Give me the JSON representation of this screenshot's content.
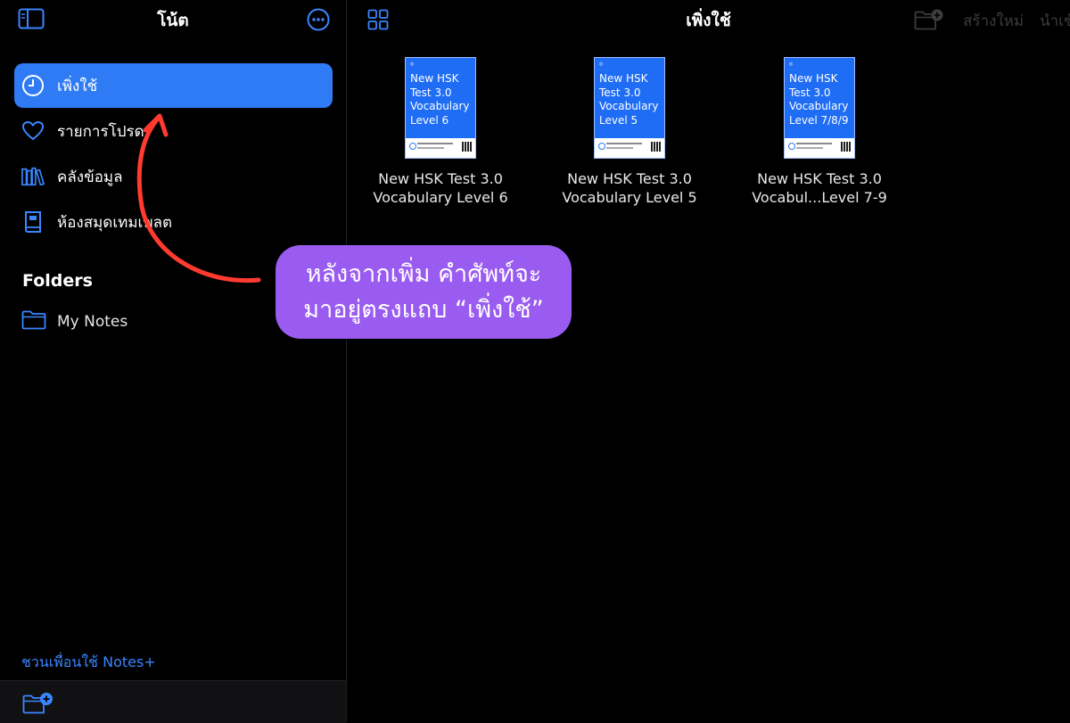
{
  "sidebar": {
    "title": "โน้ต",
    "items": [
      {
        "label": "เพิ่งใช้",
        "icon": "clock-icon",
        "active": true
      },
      {
        "label": "รายการโปรด",
        "icon": "heart-icon",
        "active": false
      },
      {
        "label": "คลังข้อมูล",
        "icon": "library-icon",
        "active": false
      },
      {
        "label": "ห้องสมุดเทมเพลต",
        "icon": "template-book-icon",
        "active": false
      }
    ],
    "folders_heading": "Folders",
    "folders": [
      {
        "label": "My Notes",
        "icon": "folder-icon"
      }
    ],
    "invite_text": "ชวนเพื่อนใช้ Notes+"
  },
  "main": {
    "title": "เพิ่งใช้",
    "create_new": "สร้างใหม่",
    "import": "นำเข้า",
    "documents": [
      {
        "cover_title": "New HSK Test 3.0 Vocabulary Level 6",
        "name_line1": "New HSK Test 3.0",
        "name_line2": "Vocabulary Level 6"
      },
      {
        "cover_title": "New HSK Test 3.0 Vocabulary Level 5",
        "name_line1": "New HSK Test 3.0",
        "name_line2": "Vocabulary Level 5"
      },
      {
        "cover_title": "New HSK Test 3.0 Vocabulary Level 7/8/9",
        "name_line1": "New HSK Test 3.0",
        "name_line2": "Vocabul...Level 7-9"
      }
    ]
  },
  "annotation": {
    "line1": "หลังจากเพิ่ม  คำศัพท์จะ",
    "line2": "มาอยู่ตรงแถบ  “เพิ่งใช้”"
  },
  "colors": {
    "accent": "#2f7bf5",
    "callout": "#9a5cf0",
    "arrow": "#ff3b30"
  }
}
